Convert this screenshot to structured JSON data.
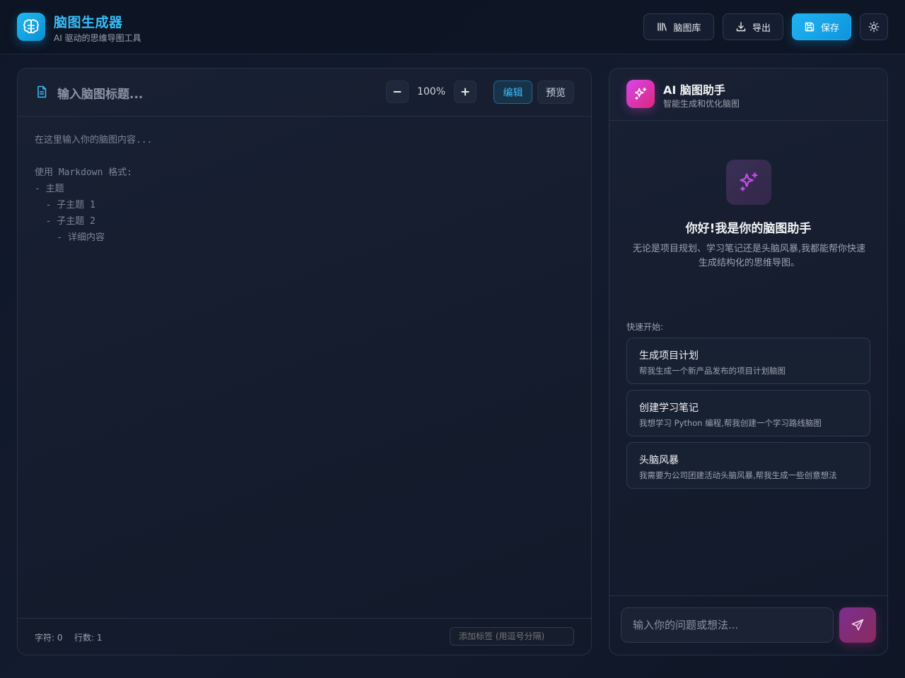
{
  "app": {
    "title": "脑图生成器",
    "subtitle": "AI 驱动的思维导图工具",
    "logo_icon": "brain-icon",
    "accent": "#0ea5e9"
  },
  "header": {
    "library_label": "脑图库",
    "export_label": "导出",
    "save_label": "保存",
    "theme_icon": "sun-icon"
  },
  "editor": {
    "title_placeholder": "输入脑图标题...",
    "zoom": "100%",
    "mode_edit": "编辑",
    "mode_preview": "预览",
    "content_placeholder": "在这里输入你的脑图内容...\n\n使用 Markdown 格式:\n- 主题\n  - 子主题 1\n  - 子主题 2\n    - 详细内容",
    "chars": "字符: 0",
    "lines": "行数: 1",
    "tag_placeholder": "添加标签 (用逗号分隔)"
  },
  "ai": {
    "title": "AI 脑图助手",
    "subtitle": "智能生成和优化脑图",
    "hero_title": "你好!我是你的脑图助手",
    "hero_text": "无论是项目规划、学习笔记还是头脑风暴,我都能帮你快速生成结构化的思维导图。",
    "quick_label": "快速开始:",
    "quick": [
      {
        "title": "生成项目计划",
        "desc": "帮我生成一个新产品发布的项目计划脑图"
      },
      {
        "title": "创建学习笔记",
        "desc": "我想学习 Python 编程,帮我创建一个学习路线脑图"
      },
      {
        "title": "头脑风暴",
        "desc": "我需要为公司团建活动头脑风暴,帮我生成一些创意想法"
      }
    ],
    "input_placeholder": "输入你的问题或想法...",
    "accent": "#d946ef"
  }
}
